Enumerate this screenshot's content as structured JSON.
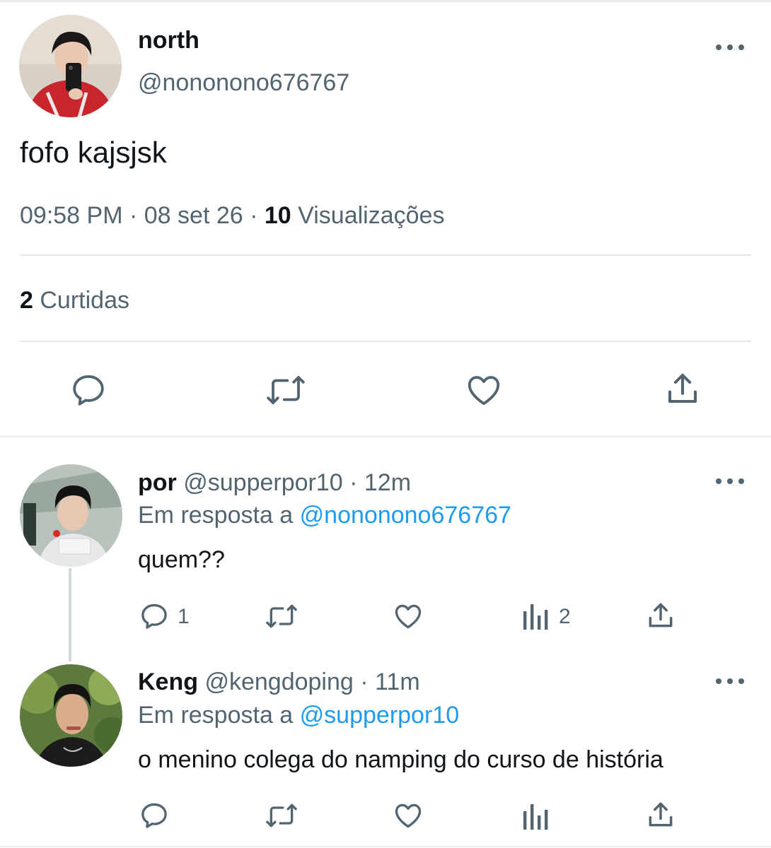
{
  "main_tweet": {
    "display_name": "north",
    "handle": "@nononono676767",
    "text": "fofo kajsjsk",
    "time": "09:58 PM",
    "sep1": "·",
    "date": "08 set 26",
    "sep2": "·",
    "views_count": "10",
    "views_label": "Visualizações",
    "likes_count": "2",
    "likes_label": "Curtidas"
  },
  "replies": [
    {
      "display_name": "por",
      "handle": "@supperpor10",
      "time": "· 12m",
      "reply_prefix": "Em resposta a",
      "reply_to": "@nononono676767",
      "text": "quem??",
      "reply_count": "1",
      "views_count": "2"
    },
    {
      "display_name": "Keng",
      "handle": "@kengdoping",
      "time": "· 11m",
      "reply_prefix": "Em resposta a",
      "reply_to": "@supperpor10",
      "text": "o menino colega do namping do curso de história",
      "reply_count": "",
      "views_count": ""
    }
  ],
  "colors": {
    "text": "#0f1419",
    "muted": "#536471",
    "link": "#1d9bf0",
    "divider": "#e3e6ea"
  },
  "icons": [
    "more-icon",
    "reply-icon",
    "retweet-icon",
    "like-icon",
    "share-icon",
    "views-icon"
  ]
}
